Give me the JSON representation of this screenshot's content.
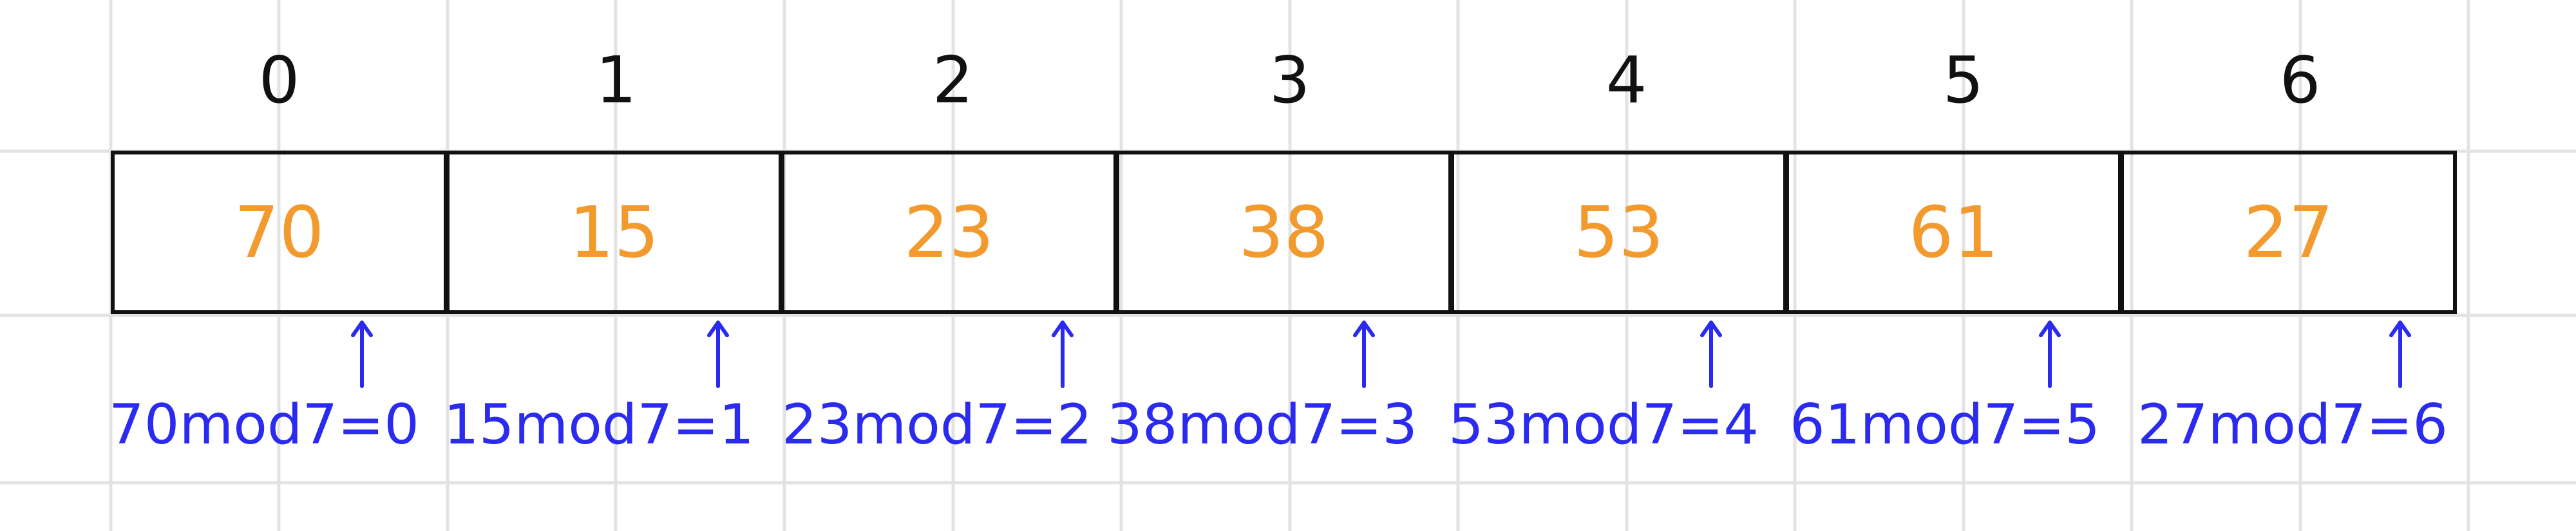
{
  "colors": {
    "index": "#111111",
    "value": "#f29a2e",
    "annotation": "#2b2bf0",
    "grid": "#e3e3e3"
  },
  "slots": [
    {
      "index": "0",
      "value": "70",
      "note": "70mod7=0"
    },
    {
      "index": "1",
      "value": "15",
      "note": "15mod7=1"
    },
    {
      "index": "2",
      "value": "23",
      "note": "23mod7=2"
    },
    {
      "index": "3",
      "value": "38",
      "note": "38mod7=3"
    },
    {
      "index": "4",
      "value": "53",
      "note": "53mod7=4"
    },
    {
      "index": "5",
      "value": "61",
      "note": "61mod7=5"
    },
    {
      "index": "6",
      "value": "27",
      "note": "27mod7=6"
    }
  ]
}
